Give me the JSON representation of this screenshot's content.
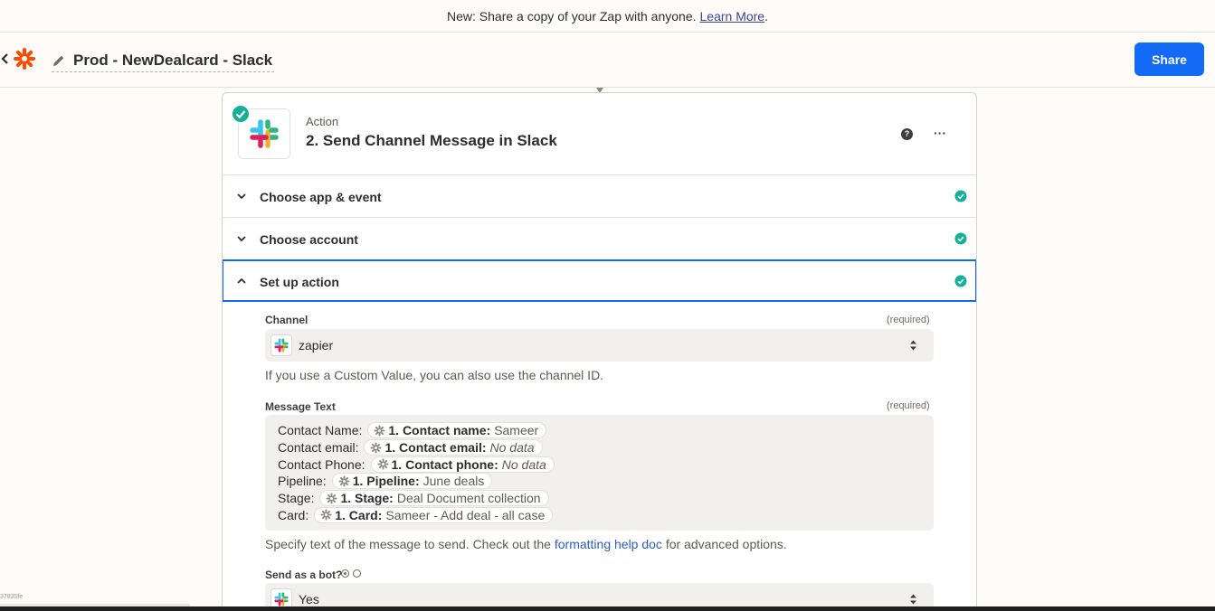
{
  "banner": {
    "text": "New: Share a copy of your Zap with anyone.",
    "link": "Learn More",
    "suffix": "."
  },
  "topbar": {
    "back_icon": "chevron-left-icon",
    "logo": "zapier-logo",
    "title": "Prod - NewDealcard - Slack",
    "share_label": "Share",
    "accent": "#136bf5",
    "brand": "#ff4a00"
  },
  "step": {
    "kind": "Action",
    "title": "2. Send Channel Message in Slack",
    "help_glyph": "?",
    "more_glyph": "···",
    "status_color": "#16b098"
  },
  "sections": [
    {
      "label": "Choose app & event",
      "expanded": false,
      "complete": true
    },
    {
      "label": "Choose account",
      "expanded": false,
      "complete": true
    },
    {
      "label": "Set up action",
      "expanded": true,
      "complete": true
    }
  ],
  "form": {
    "channel": {
      "label": "Channel",
      "required": "(required)",
      "value": "zapier",
      "hint": "If you use a Custom Value, you can also use the channel ID."
    },
    "message": {
      "label": "Message Text",
      "required": "(required)",
      "lines": [
        {
          "text": "Contact Name:",
          "field": "1. Contact name:",
          "value": "Sameer",
          "nodata": false
        },
        {
          "text": "Contact email:",
          "field": "1. Contact email:",
          "value": "No data",
          "nodata": true
        },
        {
          "text": "Contact Phone:",
          "field": "1. Contact phone:",
          "value": "No data",
          "nodata": true
        },
        {
          "text": "Pipeline:",
          "field": "1. Pipeline:",
          "value": "June deals",
          "nodata": false
        },
        {
          "text": "Stage:",
          "field": "1. Stage:",
          "value": "Deal Document collection",
          "nodata": false
        },
        {
          "text": "Card:",
          "field": "1. Card:",
          "value": "Sameer - Add deal - all case",
          "nodata": false
        }
      ],
      "hint_before": "Specify text of the message to send. Check out the",
      "hint_link": "formatting help doc",
      "hint_after": "for advanced options."
    },
    "bot": {
      "label": "Send as a bot?",
      "value": "Yes"
    }
  },
  "footer": {
    "build_id": "37835fe"
  }
}
